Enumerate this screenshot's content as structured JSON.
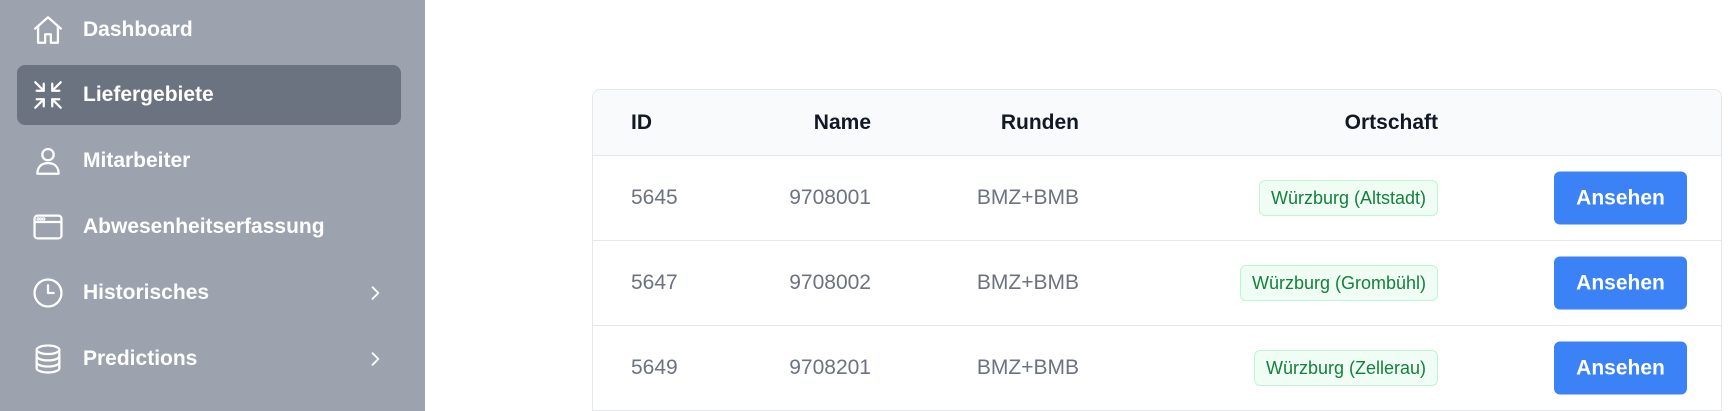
{
  "sidebar": {
    "items": [
      {
        "label": "Dashboard",
        "icon": "home-icon",
        "active": false,
        "expandable": false
      },
      {
        "label": "Liefergebiete",
        "icon": "arrows-shrink-icon",
        "active": true,
        "expandable": false
      },
      {
        "label": "Mitarbeiter",
        "icon": "user-icon",
        "active": false,
        "expandable": false
      },
      {
        "label": "Abwesenheitserfassung",
        "icon": "browser-window-icon",
        "active": false,
        "expandable": false
      },
      {
        "label": "Historisches",
        "icon": "clock-icon",
        "active": false,
        "expandable": true
      },
      {
        "label": "Predictions",
        "icon": "database-icon",
        "active": false,
        "expandable": true
      }
    ]
  },
  "table": {
    "headers": {
      "id": "ID",
      "name": "Name",
      "runden": "Runden",
      "ortschaft": "Ortschaft"
    },
    "rows": [
      {
        "id": "5645",
        "name": "9708001",
        "runden": "BMZ+BMB",
        "ortschaft": "Würzburg (Altstadt)",
        "action": "Ansehen"
      },
      {
        "id": "5647",
        "name": "9708002",
        "runden": "BMZ+BMB",
        "ortschaft": "Würzburg (Grombühl)",
        "action": "Ansehen"
      },
      {
        "id": "5649",
        "name": "9708201",
        "runden": "BMZ+BMB",
        "ortschaft": "Würzburg (Zellerau)",
        "action": "Ansehen"
      }
    ]
  },
  "colors": {
    "sidebar_bg": "#9ca3af",
    "sidebar_active": "#6b7280",
    "button": "#3b82f6",
    "badge_text": "#15803d",
    "badge_bg": "#f0fdf4"
  }
}
